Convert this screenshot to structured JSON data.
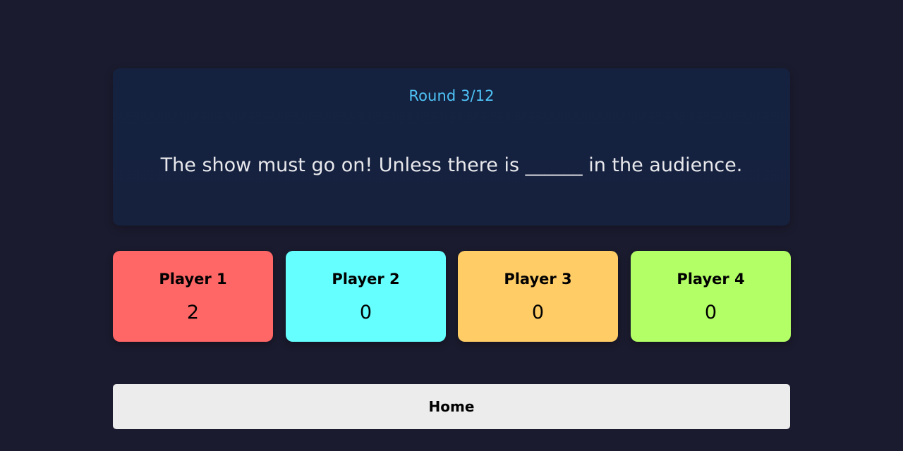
{
  "round": {
    "label": "Round 3/12"
  },
  "prompt": {
    "text": "The show must go on! Unless there is ______ in the audience."
  },
  "players": [
    {
      "name": "Player 1",
      "score": "2",
      "color": "#ff6666"
    },
    {
      "name": "Player 2",
      "score": "0",
      "color": "#66ffff"
    },
    {
      "name": "Player 3",
      "score": "0",
      "color": "#ffcc66"
    },
    {
      "name": "Player 4",
      "score": "0",
      "color": "#b3ff66"
    }
  ],
  "actions": {
    "home_label": "Home"
  },
  "colors": {
    "background": "#1b1b2f",
    "card": "#16213e",
    "accent": "#4fc3f7",
    "button": "#ececec"
  }
}
